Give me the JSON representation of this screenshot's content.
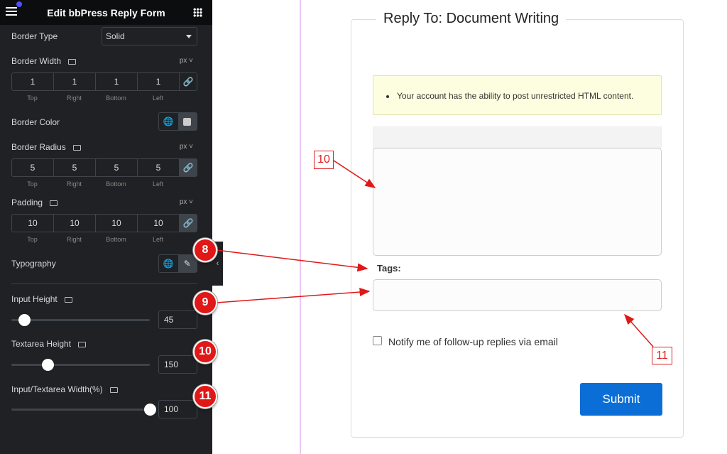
{
  "panel": {
    "title": "Edit bbPress Reply Form",
    "border_type": {
      "label": "Border Type",
      "value": "Solid"
    },
    "border_width": {
      "label": "Border Width",
      "unit": "px",
      "values": [
        "1",
        "1",
        "1",
        "1"
      ]
    },
    "border_color": {
      "label": "Border Color"
    },
    "border_radius": {
      "label": "Border Radius",
      "unit": "px",
      "values": [
        "5",
        "5",
        "5",
        "5"
      ]
    },
    "padding": {
      "label": "Padding",
      "unit": "px",
      "values": [
        "10",
        "10",
        "10",
        "10"
      ]
    },
    "sides": [
      "Top",
      "Right",
      "Bottom",
      "Left"
    ],
    "typography": {
      "label": "Typography"
    },
    "input_height": {
      "label": "Input Height",
      "value": "45",
      "slider_fraction": 0.09
    },
    "textarea_height": {
      "label": "Textarea Height",
      "value": "150",
      "slider_fraction": 0.26
    },
    "width": {
      "label": "Input/Textarea Width(%)",
      "value": "100",
      "slider_fraction": 1.0
    }
  },
  "form": {
    "title": "Reply To: Document Writing",
    "notice": "Your account has the ability to post unrestricted HTML content.",
    "tags_label": "Tags:",
    "notify_label": "Notify me of follow-up replies via email",
    "submit": "Submit",
    "accent": "#0b6ed6"
  },
  "annotations": {
    "badges": [
      "8",
      "9",
      "10",
      "11"
    ],
    "boxes": [
      "10",
      "11"
    ],
    "color": "#e01818"
  }
}
